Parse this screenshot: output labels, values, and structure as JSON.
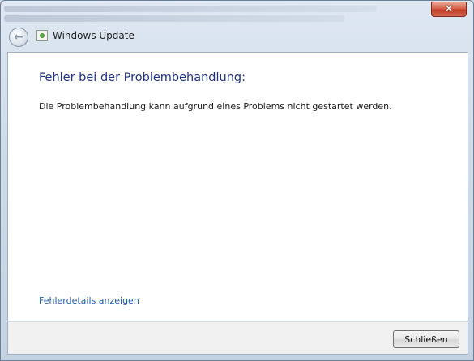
{
  "window": {
    "title": "Windows Update",
    "close_glyph": "✕",
    "back_glyph": "←",
    "back_icon": "back-arrow-icon",
    "app_icon": "windows-update-icon"
  },
  "content": {
    "heading": "Fehler bei der Problembehandlung:",
    "message": "Die Problembehandlung kann aufgrund eines Problems nicht gestartet werden.",
    "details_link": "Fehlerdetails anzeigen"
  },
  "footer": {
    "close_button": "Schließen"
  },
  "colors": {
    "heading": "#1e3287",
    "link": "#1c5aa8",
    "close_button_red": "#c23f28"
  }
}
